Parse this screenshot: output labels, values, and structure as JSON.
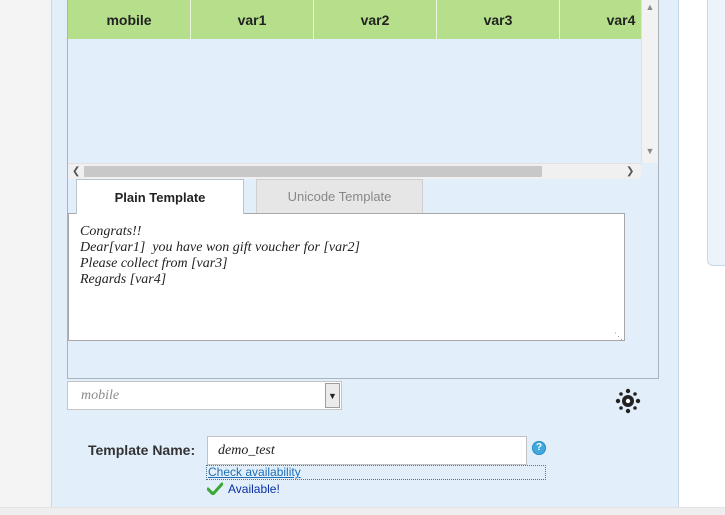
{
  "grid": {
    "columns": [
      "mobile",
      "var1",
      "var2",
      "var3",
      "var4"
    ]
  },
  "tabs": {
    "plain": "Plain Template",
    "unicode": "Unicode Template"
  },
  "template_text": "Congrats!!\nDear[var1]  you have won gift voucher for [var2]\nPlease collect from [var3]\nRegards [var4]",
  "column_select": {
    "selected": "mobile"
  },
  "template_name": {
    "label": "Template Name:",
    "value": "demo_test",
    "help": "?",
    "check_link": "Check availability",
    "status": "Available!"
  },
  "colors": {
    "header_green": "#b5df8a",
    "panel_blue": "#e2effa",
    "link_blue": "#1d6fb8",
    "status_blue": "#0a2fa6",
    "check_green": "#3aa832"
  },
  "icons": {
    "settings": "cog-dots-icon",
    "help": "question-circle-icon",
    "available": "checkmark-icon"
  }
}
